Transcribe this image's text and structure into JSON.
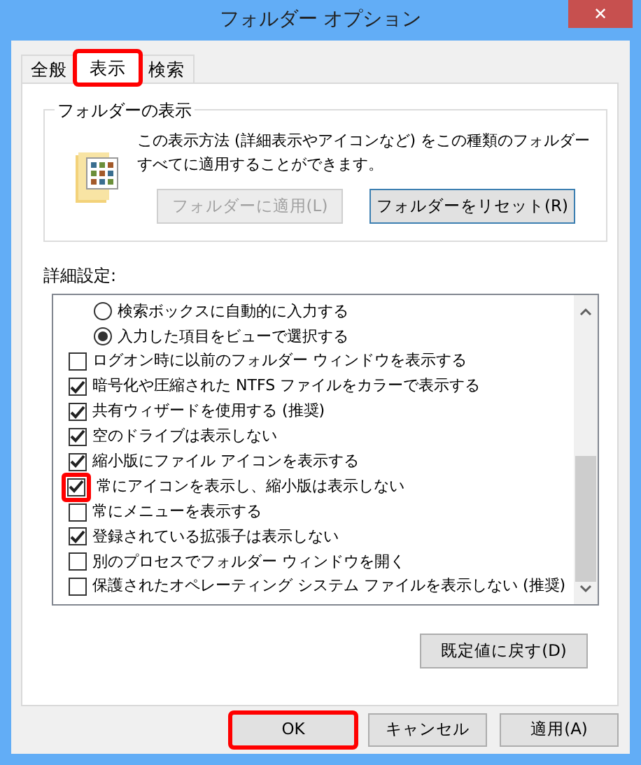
{
  "window": {
    "title": "フォルダー オプション",
    "close": "✕"
  },
  "tabs": [
    {
      "label": "全般",
      "selected": false,
      "highlighted": false
    },
    {
      "label": "表示",
      "selected": true,
      "highlighted": true
    },
    {
      "label": "検索",
      "selected": false,
      "highlighted": false
    }
  ],
  "folder_views": {
    "title": "フォルダーの表示",
    "description": "この表示方法 (詳細表示やアイコンなど) をこの種類のフォルダーすべてに適用することができます。",
    "buttons": [
      {
        "label": "フォルダーに適用(L)",
        "disabled": true
      },
      {
        "label": "フォルダーをリセット(R)",
        "disabled": false
      }
    ]
  },
  "advanced": {
    "title": "詳細設定:",
    "items": [
      {
        "kind": "radio",
        "label": "検索ボックスに自動的に入力する",
        "checked": false,
        "highlighted": false
      },
      {
        "kind": "radio",
        "label": "入力した項目をビューで選択する",
        "checked": true,
        "highlighted": false
      },
      {
        "kind": "checkbox",
        "label": "ログオン時に以前のフォルダー ウィンドウを表示する",
        "checked": false,
        "highlighted": false
      },
      {
        "kind": "checkbox",
        "label": "暗号化や圧縮された NTFS ファイルをカラーで表示する",
        "checked": true,
        "highlighted": false
      },
      {
        "kind": "checkbox",
        "label": "共有ウィザードを使用する (推奨)",
        "checked": true,
        "highlighted": false
      },
      {
        "kind": "checkbox",
        "label": "空のドライブは表示しない",
        "checked": true,
        "highlighted": false
      },
      {
        "kind": "checkbox",
        "label": "縮小版にファイル アイコンを表示する",
        "checked": true,
        "highlighted": false
      },
      {
        "kind": "checkbox",
        "label": "常にアイコンを表示し、縮小版は表示しない",
        "checked": true,
        "highlighted": true
      },
      {
        "kind": "checkbox",
        "label": "常にメニューを表示する",
        "checked": false,
        "highlighted": false
      },
      {
        "kind": "checkbox",
        "label": "登録されている拡張子は表示しない",
        "checked": true,
        "highlighted": false
      },
      {
        "kind": "checkbox",
        "label": "別のプロセスでフォルダー ウィンドウを開く",
        "checked": false,
        "highlighted": false
      },
      {
        "kind": "checkbox",
        "label": "保護されたオペレーティング システム ファイルを表示しない (推奨)",
        "checked": false,
        "highlighted": false
      }
    ],
    "restore_button": "既定値に戻す(D)"
  },
  "buttons": [
    {
      "label": "OK",
      "highlighted": true
    },
    {
      "label": "キャンセル",
      "highlighted": false
    },
    {
      "label": "適用(A)",
      "highlighted": false
    }
  ]
}
